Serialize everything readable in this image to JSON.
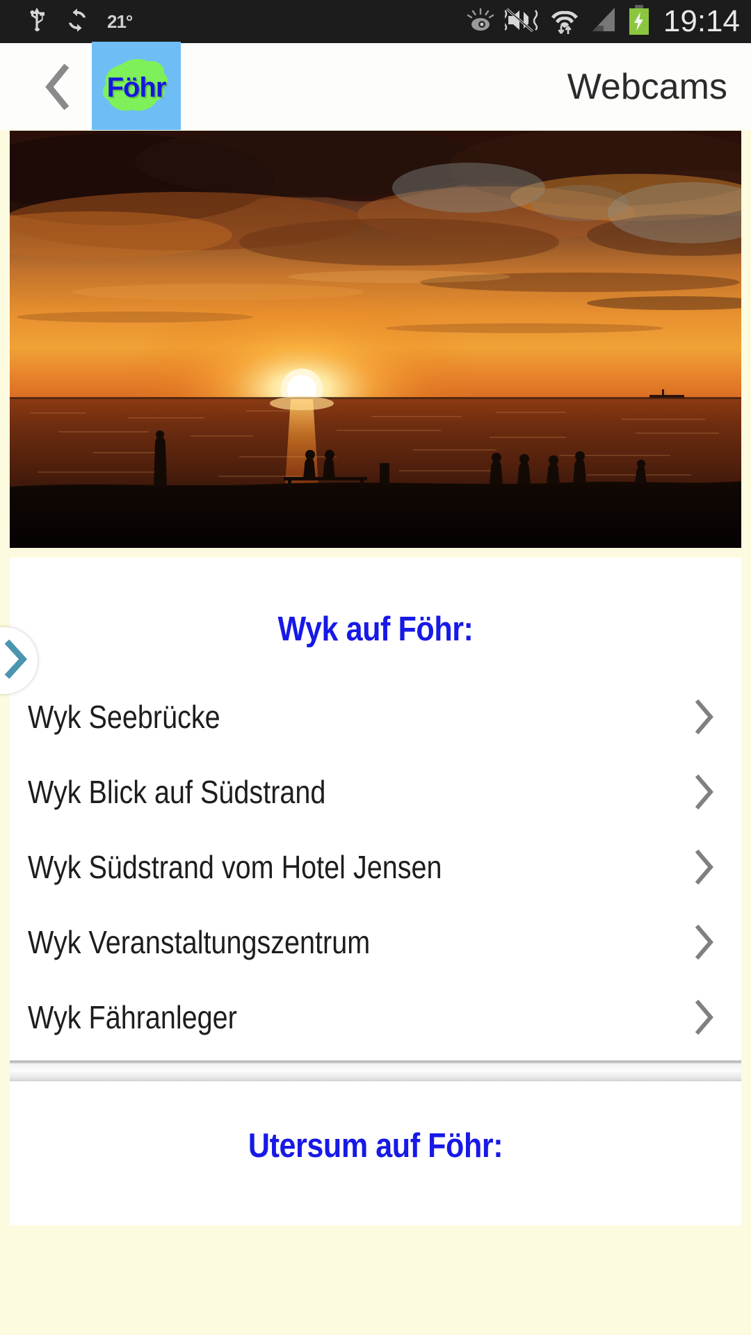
{
  "statusbar": {
    "temperature": "21°",
    "clock": "19:14",
    "icons_left": [
      "usb-icon",
      "sync-icon"
    ],
    "icons_right": [
      "smart-stay-eye-icon",
      "sound-muted-vibrate-icon",
      "wifi-transfer-icon",
      "cellular-signal-icon",
      "battery-charging-icon"
    ],
    "battery_color": "#8cc63f",
    "background": "#1c1c1c"
  },
  "actionbar": {
    "back_label": "‹",
    "logo_text": "Föhr",
    "logo_bg": "#6fbdf5",
    "logo_island": "#7ef05a",
    "title": "Webcams",
    "background": "#fdfdfb"
  },
  "hero": {
    "alt": "Sonnenuntergang am Strand",
    "name": "sunset-beach-photo"
  },
  "page": {
    "background": "#fdfbdf",
    "card_background": "#ffffff",
    "accent_blue": "#1719e6",
    "chevron_color": "#808080"
  },
  "edge_handle": {
    "glyph": "›",
    "color": "#4a96ae"
  },
  "sections": [
    {
      "title": "Wyk auf Föhr:",
      "items": [
        {
          "label": "Wyk Seebrücke",
          "chevron": "›"
        },
        {
          "label": "Wyk Blick auf Südstrand",
          "chevron": "›"
        },
        {
          "label": "Wyk Südstrand vom Hotel Jensen",
          "chevron": "›"
        },
        {
          "label": "Wyk Veranstaltungszentrum",
          "chevron": "›"
        },
        {
          "label": "Wyk Fähranleger",
          "chevron": "›"
        }
      ]
    },
    {
      "title": "Utersum auf Föhr:",
      "items": []
    }
  ]
}
